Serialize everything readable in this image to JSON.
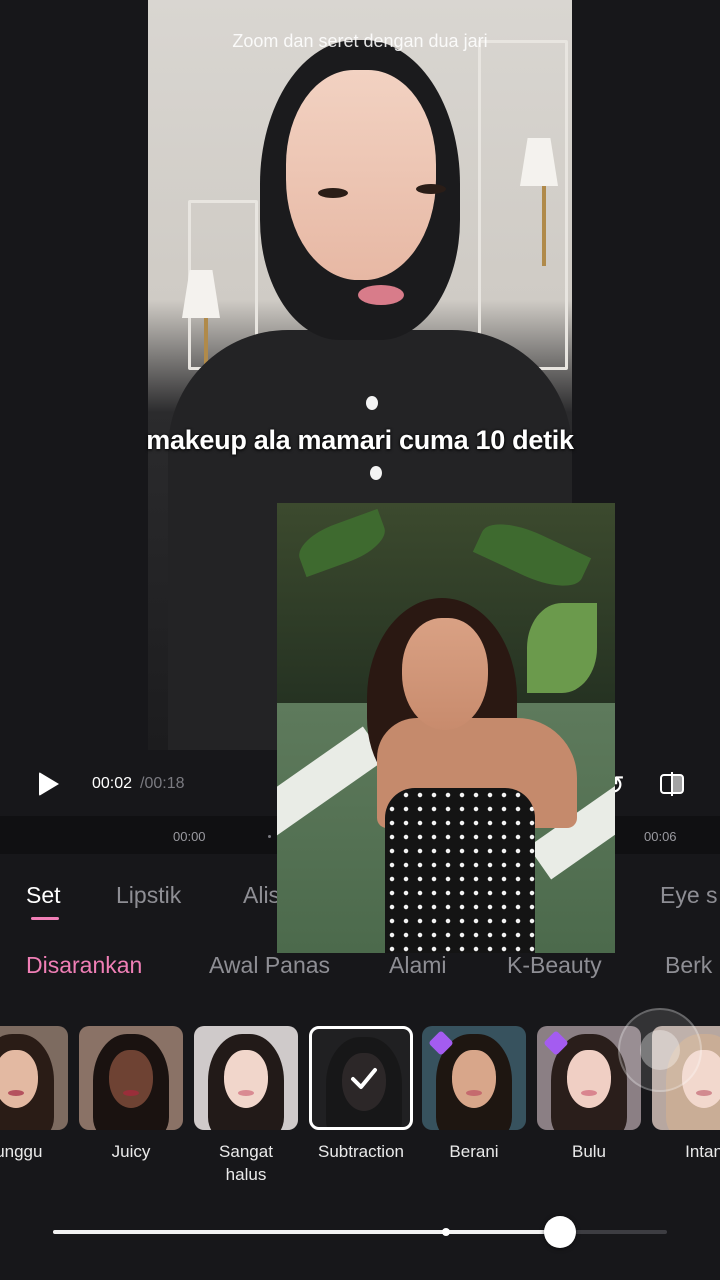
{
  "preview": {
    "zoom_hint": "Zoom dan seret dengan dua jari",
    "caption": "makeup ala mamari cuma 10 detik"
  },
  "playback": {
    "current_time": "00:02",
    "total_time": "/00:18",
    "undo_icon": "undo-icon",
    "compare_icon": "compare-icon"
  },
  "timeline": {
    "ticks": [
      "00:00",
      "00:06"
    ]
  },
  "categories": [
    {
      "label": "Set",
      "active": true
    },
    {
      "label": "Lipstik",
      "active": false
    },
    {
      "label": "Alis",
      "active": false
    },
    {
      "label": "Eye s",
      "active": false
    }
  ],
  "sub_categories": [
    {
      "label": "Disarankan",
      "active": true
    },
    {
      "label": "Awal Panas",
      "active": false
    },
    {
      "label": "Alami",
      "active": false
    },
    {
      "label": "K-Beauty",
      "active": false
    },
    {
      "label": "Berk",
      "active": false
    }
  ],
  "presets": [
    {
      "label": "runggu",
      "premium": false,
      "selected": false
    },
    {
      "label": "Juicy",
      "premium": false,
      "selected": false
    },
    {
      "label": "Sangat halus",
      "premium": false,
      "selected": false
    },
    {
      "label": "Subtraction",
      "premium": false,
      "selected": true
    },
    {
      "label": "Berani",
      "premium": true,
      "selected": false
    },
    {
      "label": "Bulu",
      "premium": true,
      "selected": false
    },
    {
      "label": "Intan",
      "premium": false,
      "selected": false
    }
  ],
  "slider": {
    "value": 0.825,
    "default_marker": 0.64
  },
  "colors": {
    "accent_pink": "#f07fb6",
    "background": "#17171a",
    "premium_gem": "#a45cf0"
  }
}
